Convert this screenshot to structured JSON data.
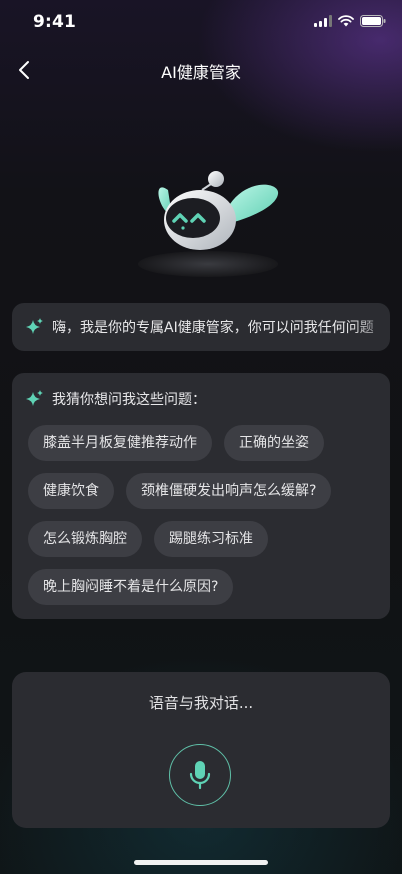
{
  "status_bar": {
    "time": "9:41"
  },
  "header": {
    "title": "AI健康管家"
  },
  "greeting": {
    "text": "嗨，我是你的专属AI健康管家，你可以问我任何问题"
  },
  "suggestions": {
    "heading": "我猜你想问我这些问题：",
    "items": [
      "膝盖半月板复健推荐动作",
      "正确的坐姿",
      "健康饮食",
      "颈椎僵硬发出响声怎么缓解?",
      "怎么锻炼胸腔",
      "踢腿练习标准",
      "晚上胸闷睡不着是什么原因?"
    ]
  },
  "voice": {
    "hint": "语音与我对话..."
  },
  "colors": {
    "accent": "#5fd3b5",
    "card": "#2b2c31",
    "chip": "#3d3e44"
  },
  "icons": [
    "signal-icon",
    "wifi-icon",
    "battery-icon",
    "back-arrow-icon",
    "sparkle-icon",
    "microphone-icon"
  ]
}
